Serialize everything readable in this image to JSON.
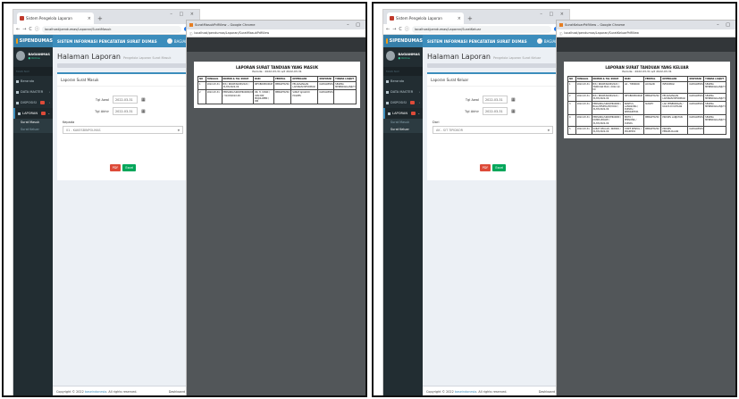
{
  "left": {
    "browser": {
      "tab_title": "Sistem Pengelola Laporan",
      "tab_close": "×",
      "new_tab": "+",
      "window_controls": "– □ ×",
      "url": "localhost/pendumas/Laporan/SuratMasuk",
      "back": "←",
      "forward": "→",
      "reload": "C",
      "info": "ⓘ"
    },
    "app": {
      "brand": "SIPENDUMAS",
      "title": "SISTEM INFORMASI PENCATATAN SURAT DUMAS",
      "user_chip": "BAGIANMAS",
      "sidebar": {
        "user_name": "BAGIANMAS",
        "user_status": "● Online",
        "section": "MAIN NAV",
        "items": [
          {
            "label": "Beranda"
          },
          {
            "label": "DATA MASTER"
          },
          {
            "label": "DISPOSISI"
          },
          {
            "label": "LAPORAN"
          }
        ],
        "subitems": [
          "Surat Masuk",
          "Surat Keluar"
        ]
      },
      "page_title": "Halaman Laporan",
      "page_subtitle": "Pengelola Laporan Surat Masuk",
      "box_title": "Laporan Surat Masuk",
      "tgl_awal_label": "Tgl Awal",
      "tgl_awal_value": "2022-03-31",
      "tgl_akhir_label": "Tgl Akhir",
      "tgl_akhir_value": "2022-03-31",
      "select_label": "Kepada",
      "select_value": "01 - KAKESBINPOLMAS",
      "btn_pdf": "PDF",
      "btn_excel": "Excel",
      "footer_copyright": "Copyright © 2022",
      "footer_link": "baseindonesia",
      "footer_rights": ". All rights reserved.",
      "footer_right": "Dashboard Admin"
    },
    "pdf": {
      "window_title": "SuratMasukPdfView – Google Chrome",
      "url": "localhost/pendumas/Laporan/SuratMasukPdfView",
      "title": "LAPORAN SURAT TANDUAN YANG MASUK",
      "period": "Periode : 2022-03-31 s/d 2022-03-31",
      "headers": [
        "NO",
        "TANGGAL",
        "NOMOR & TGL SURAT",
        "DARI",
        "PERIHAL",
        "KEPERLUAN",
        "DISPOSISI",
        "TINDAK LANJUT"
      ],
      "rows": [
        [
          "1",
          "2022-03-31",
          "B/6 / INKOP/SKDP/2022 / 31/03/2022-09",
          "INFOBIDPROPAM",
          "MENGETAHUI",
          "PELAKSANAAN LAPORAN INFORMASI",
          "KAPOLRESTA",
          "SEGERA MENINDAKLANJUTI"
        ],
        [
          "2",
          "2022-03-31",
          "PERSONIL/SKDP/PROPAM/03 / 31/03/2022-09",
          "DR. H. YANDI / ASN MAT MOJOLOPEN / DIR",
          "MENGETAHUI",
          "SURAT AJUAN DI POLRES",
          "KAPOLRESTA",
          ""
        ]
      ]
    }
  },
  "right": {
    "browser": {
      "tab_title": "Sistem Pengelola Laporan",
      "tab_close": "×",
      "new_tab": "+",
      "window_controls": "– □ ×",
      "url": "localhost/pendumas/Laporan/SuratKeluar",
      "back": "←",
      "forward": "→",
      "reload": "C",
      "info": "ⓘ"
    },
    "app": {
      "brand": "SIPENDUMAS",
      "title": "SISTEM INFORMASI PENCATATAN SURAT DUMAS",
      "user_chip": "BAGIANMAS",
      "sidebar": {
        "user_name": "BAGIANMAS",
        "user_status": "● Online",
        "section": "MAIN NAV",
        "items": [
          {
            "label": "Beranda"
          },
          {
            "label": "DATA MASTER"
          },
          {
            "label": "DISPOSISI"
          },
          {
            "label": "LAPORAN"
          }
        ],
        "subitems": [
          "Surat Masuk",
          "Surat Keluar"
        ]
      },
      "page_title": "Halaman Laporan",
      "page_subtitle": "Pengelola Laporan Surat Keluar",
      "box_title": "Laporan Surat Keluar",
      "tgl_awal_label": "Tgl Awal",
      "tgl_awal_value": "2022-03-31",
      "tgl_akhir_label": "Tgl Akhir",
      "tgl_akhir_value": "2022-03-31",
      "select_label": "Dari",
      "select_value": "AK - SIT TIPIDKOR",
      "btn_pdf": "PDF",
      "btn_excel": "Excel",
      "footer_copyright": "Copyright © 2022",
      "footer_link": "baseindonesia",
      "footer_rights": ". All rights reserved.",
      "footer_right": "Dashboard Admin"
    },
    "pdf": {
      "window_title": "SuratKeluarPdfView – Google Chrome",
      "url": "localhost/pendumas/Laporan/SuratKeluarPdfView",
      "title": "LAPORAN SURAT TANDUAN YANG KELUAR",
      "period": "Periode : 2022-03-31 s/d 2022-03-31",
      "headers": [
        "NO",
        "TANGGAL",
        "NOMOR & TGL SURAT",
        "DARI",
        "PERIHAL",
        "KEPERLUAN",
        "DISPOSISI",
        "TINDAK LANJUT"
      ],
      "rows": [
        [
          "1",
          "2022-03-31",
          "B/6 / INKOP/SKDP/2022 / TANDUAN MAS / 2022-12-09",
          "AK - TIPIDKOR",
          "LOUSAIN",
          "INFORMASI",
          "KAPOLRESTA",
          "SEGERA MENINDAKLANJUTI"
        ],
        [
          "2",
          "2022-03-31",
          "B/6 / INKOP/SKDP/2022 / 31/03/2022-09",
          "INFOBIDPROPAM",
          "MENGETAHUI",
          "PELAKSANAAN LAPORAN INFORMASI",
          "KAPOLRESTA",
          "SEGERA MENINDAKLANJUTI"
        ],
        [
          "3",
          "2022-03-31",
          "PERSONIL/SKDP/PROPAM / BALL/KESPOL/DP/2022 / 31/03/2022-09",
          "BANTUS LANGSUNG / DUMAS / KEPOLRESTA",
          "SURVEY",
          "LAP. PENERIMAAN / KASUS DI KOTAAN",
          "KAPOLRESTA",
          "SEGERA MENINDAKLANJUTI"
        ],
        [
          "4",
          "2022-03-31",
          "PERSONIL/SKDP/PROPAM / DUMPL/POLRE / 31/03/2022-09",
          "MOTO / PERSONIL / DUMAS",
          "MENGETAHUI",
          "PROSES LANJUTAN",
          "KAPOLRESTA",
          "SEGERA MENINDAKLANJUTI"
        ],
        [
          "5",
          "2022-03-31",
          "SURAT KELUAR / NOMOR / 31/03/2022-09",
          "STATE KESPOL / POLRESTA",
          "MENGETAHUI",
          "PROSES PENGELOLAAN",
          "KAPOLRESTA",
          ""
        ]
      ]
    }
  }
}
